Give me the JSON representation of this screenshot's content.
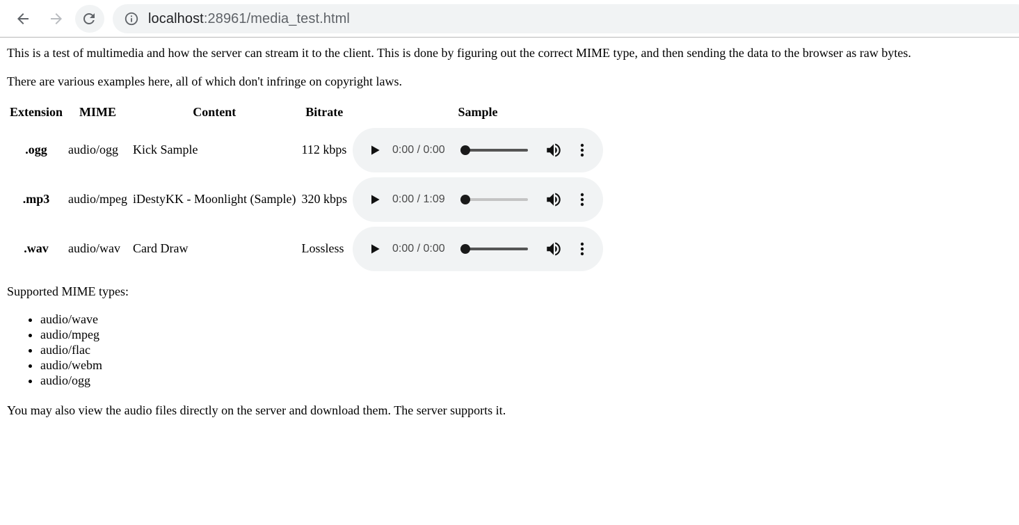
{
  "browser": {
    "url_host": "localhost",
    "url_rest": ":28961/media_test.html"
  },
  "page": {
    "intro": "This is a test of multimedia and how the server can stream it to the client. This is done by figuring out the correct MIME type, and then sending the data to the browser as raw bytes.",
    "examples_note": "There are various examples here, all of which don't infringe on copyright laws.",
    "table": {
      "headers": [
        "Extension",
        "MIME",
        "Content",
        "Bitrate",
        "Sample"
      ],
      "rows": [
        {
          "ext": ".ogg",
          "mime": "audio/ogg",
          "content": "Kick Sample",
          "bitrate": "112 kbps",
          "player_time": "0:00 / 0:00",
          "player_loaded": true
        },
        {
          "ext": ".mp3",
          "mime": "audio/mpeg",
          "content": "iDestyKK - Moonlight (Sample)",
          "bitrate": "320 kbps",
          "player_time": "0:00 / 1:09",
          "player_loaded": false
        },
        {
          "ext": ".wav",
          "mime": "audio/wav",
          "content": "Card Draw",
          "bitrate": "Lossless",
          "player_time": "0:00 / 0:00",
          "player_loaded": true
        }
      ]
    },
    "supported_label": "Supported MIME types:",
    "supported_types": [
      "audio/wave",
      "audio/mpeg",
      "audio/flac",
      "audio/webm",
      "audio/ogg"
    ],
    "footer_note": "You may also view the audio files directly on the server and download them. The server supports it."
  },
  "icons": {
    "back": "arrow-left-icon",
    "forward": "arrow-right-icon",
    "reload": "reload-icon",
    "info": "info-icon",
    "play": "play-icon",
    "volume": "volume-icon",
    "more": "more-vert-icon"
  },
  "colors": {
    "omnibox_bg": "#f1f3f4",
    "player_bg": "#f1f3f4"
  }
}
